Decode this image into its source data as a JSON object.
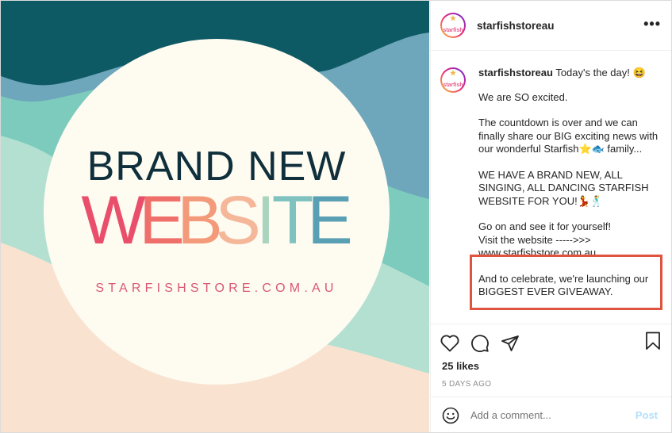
{
  "post_image": {
    "line1": "BRAND NEW",
    "line2_letters": [
      "W",
      "E",
      "B",
      "S",
      "I",
      "T",
      "E"
    ],
    "line2_colors": [
      "#e94f6a",
      "#ef6f6a",
      "#f29a79",
      "#f5b79a",
      "#a9d5bf",
      "#7fc2c0",
      "#5aa0b4"
    ],
    "domain": "STARFISHSTORE.COM.AU"
  },
  "colors": {
    "dark_teal": "#0d5964",
    "steel_blue": "#6ea6bb",
    "mint": "#7dcbbd",
    "light_mint": "#b3e0d1",
    "peach": "#f9e3d0",
    "circle": "#fefbf1",
    "title_text": "#0e2f3b",
    "domain_text": "#d8587a",
    "highlight_box": "#e0533f"
  },
  "header": {
    "username": "starfishstoreau",
    "avatar_text": "starfish",
    "more_label": "•••"
  },
  "caption": {
    "username": "starfishstoreau",
    "first_line": "Today's the day! 😆",
    "paragraphs": [
      "We are SO excited.",
      "The countdown is over and we can finally share our BIG exciting news with our wonderful Starfish⭐🐟 family...",
      "WE HAVE A BRAND NEW, ALL SINGING, ALL DANCING STARFISH WEBSITE FOR YOU!💃🕺",
      "Go on and see it for yourself!\nVisit the website ----->>>\nwww.starfishstore.com.au",
      "And to celebrate, we're launching our BIGGEST EVER GIVEAWAY."
    ]
  },
  "actions": {
    "icons": [
      "heart-icon",
      "comment-icon",
      "share-icon",
      "bookmark-icon"
    ],
    "likes": "25 likes",
    "time_ago": "5 DAYS AGO"
  },
  "comment_box": {
    "placeholder": "Add a comment...",
    "post_label": "Post"
  }
}
